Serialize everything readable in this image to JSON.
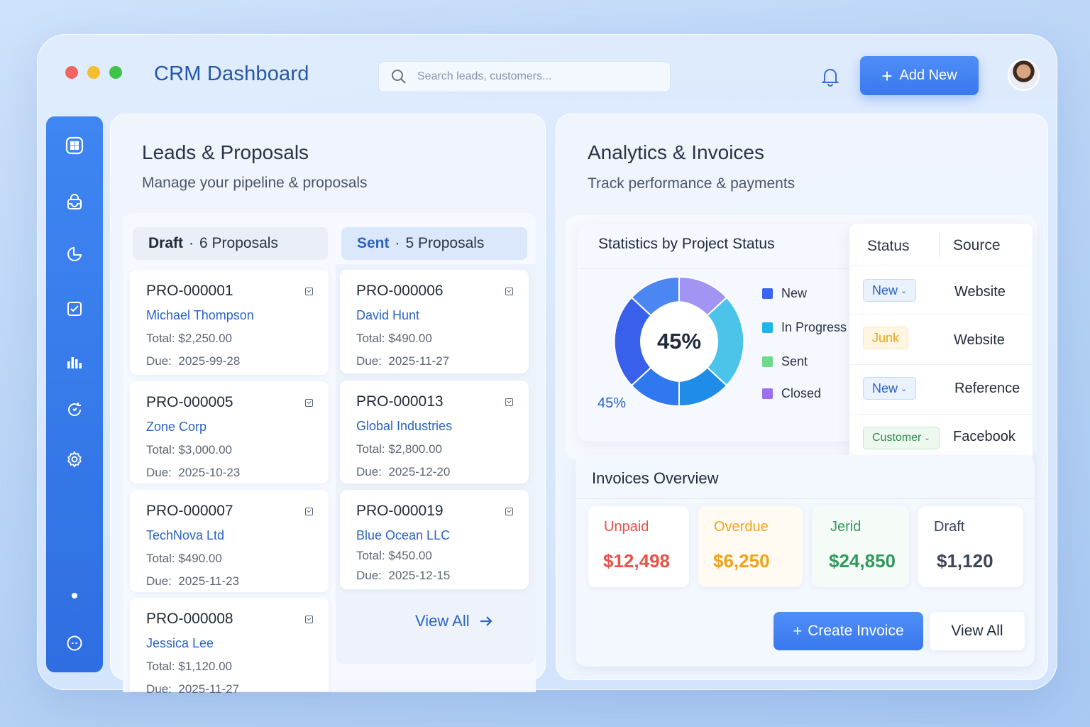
{
  "header": {
    "title": "CRM Dashboard",
    "search_placeholder": "Search leads, customers...",
    "add_label": "Add New"
  },
  "colors": {
    "accent": "#3a78ee",
    "dot_red": "#f2655e",
    "dot_yellow": "#f6bd2f",
    "dot_green": "#3ec24a"
  },
  "sidebar": {
    "items": [
      {
        "icon": "dashboard-icon"
      },
      {
        "icon": "inbox-icon"
      },
      {
        "icon": "pie-chart-icon"
      },
      {
        "icon": "task-check-icon"
      },
      {
        "icon": "bar-chart-icon"
      },
      {
        "icon": "refresh-icon"
      },
      {
        "icon": "settings-icon"
      },
      {
        "icon": "dot-icon"
      },
      {
        "icon": "chat-icon"
      }
    ]
  },
  "leads": {
    "title": "Leads & Proposals",
    "subtitle": "Manage your pipeline & proposals",
    "draft": {
      "label": "Draft",
      "count": "6 Proposals",
      "cards": [
        {
          "id": "PRO-000001",
          "name": "Michael Thompson",
          "total": "$2,250.00",
          "due": "2025-99-28"
        },
        {
          "id": "PRO-000005",
          "name": "Zone Corp",
          "total": "$3,000.00",
          "due": "2025-10-23"
        },
        {
          "id": "PRO-000007",
          "name": "TechNova Ltd",
          "total": "$490.00",
          "due": "2025-11-23"
        },
        {
          "id": "PRO-000008",
          "name": "Jessica Lee",
          "total": "$1,120.00",
          "due": "2025-11-27"
        }
      ]
    },
    "sent": {
      "label": "Sent",
      "count": "5 Proposals",
      "cards": [
        {
          "id": "PRO-000006",
          "name": "David Hunt",
          "total": "$490.00",
          "due": "2025-11-27"
        },
        {
          "id": "PRO-000013",
          "name": "Global Industries",
          "total": "$2,800.00",
          "due": "2025-12-20"
        },
        {
          "id": "PRO-000019",
          "name": "Blue Ocean LLC",
          "total": "$450.00",
          "due": "2025-12-15"
        }
      ]
    },
    "total_prefix": "Total:",
    "due_prefix": "Due:",
    "view_all": "View All"
  },
  "analytics": {
    "title": "Analytics & Invoices",
    "subtitle": "Track performance & payments",
    "stats_title": "Statistics by Project Status",
    "center_label": "45%",
    "corner_label": "45%",
    "legend": [
      {
        "name": "New",
        "color": "#3b64f0"
      },
      {
        "name": "In Progress",
        "color": "#22b5e8"
      },
      {
        "name": "Sent",
        "color": "#6fd98b"
      },
      {
        "name": "Closed",
        "color": "#9d6ff0"
      }
    ],
    "table": {
      "col_status": "Status",
      "col_source": "Source",
      "rows": [
        {
          "status": "New",
          "source": "Website"
        },
        {
          "status": "Junk",
          "source": "Website"
        },
        {
          "status": "New",
          "source": "Reference"
        },
        {
          "status": "Customer",
          "source": "Facebook"
        }
      ]
    }
  },
  "invoices": {
    "title": "Invoices Overview",
    "tiles": [
      {
        "label": "Unpaid",
        "value": "$12,498",
        "color": "#e8524a"
      },
      {
        "label": "Overdue",
        "value": "$6,250",
        "color": "#f2a31c"
      },
      {
        "label": "Jerid",
        "value": "$24,850",
        "color": "#2f9a5e"
      },
      {
        "label": "Draft",
        "value": "$1,120",
        "color": "#3b4556"
      }
    ],
    "create_label": "Create Invoice",
    "view_all_label": "View All"
  }
}
